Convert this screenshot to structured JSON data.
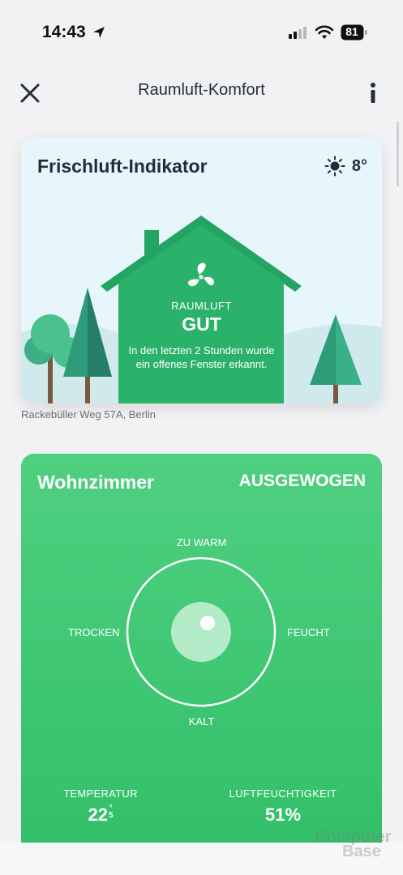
{
  "status_bar": {
    "time": "14:43",
    "battery": "81",
    "icons": [
      "location-arrow-icon",
      "cellular-signal-icon",
      "wifi-icon",
      "battery-icon"
    ]
  },
  "header": {
    "title": "Raumluft-Komfort",
    "close_icon": "close-icon",
    "info_icon": "info-icon"
  },
  "fresh_air_card": {
    "title": "Frischluft-Indikator",
    "weather_icon": "sun-icon",
    "outside_temperature": "8°",
    "fan_icon": "fan-icon",
    "status_label": "RAUMLUFT",
    "status_value": "GUT",
    "description": "In den letzten 2 Stunden wurde ein offenes Fenster erkannt.",
    "address": "Rackebüller Weg 57A, Berlin"
  },
  "room_card": {
    "room_name": "Wohnzimmer",
    "comfort_status": "AUSGEWOGEN",
    "axis_top": "ZU WARM",
    "axis_bottom": "KALT",
    "axis_left": "TROCKEN",
    "axis_right": "FEUCHT",
    "temperature_label": "TEMPERATUR",
    "temperature_value": "22",
    "temperature_superscript": "°",
    "temperature_subscript": "5",
    "humidity_label": "LUFTFEUCHTIGKEIT",
    "humidity_value": "51%"
  },
  "colors": {
    "card_green": "#3cc873",
    "house_green": "#2bb26a",
    "sky_blue": "#e7f6fb",
    "title_dark": "#1f2d3d"
  },
  "watermark": {
    "line1": "Computer",
    "line2": "Base"
  }
}
